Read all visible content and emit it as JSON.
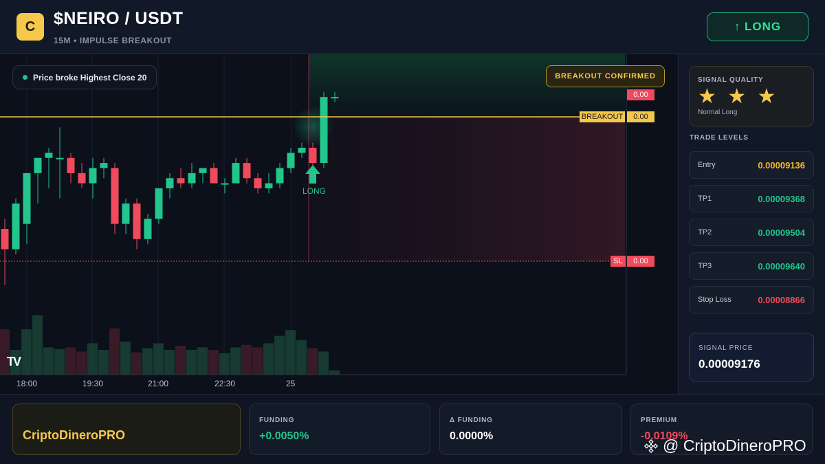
{
  "header": {
    "logo_letter": "C",
    "pair": "$NEIRO / USDT",
    "subtitle": "15M • IMPULSE BREAKOUT",
    "direction_button": "↑ LONG"
  },
  "chart": {
    "condition_text": "Price broke Highest Close 20",
    "badge": "BREAKOUT CONFIRMED",
    "signal_marker": "LONG",
    "tags": {
      "top_price": "0.00",
      "breakout_label": "BREAKOUT",
      "breakout_price": "0.00",
      "sl_label": "SL",
      "sl_price": "0.00"
    },
    "watermark_logo": "TV",
    "time_labels": [
      "18:00",
      "19:30",
      "21:00",
      "22:30",
      "25"
    ]
  },
  "chart_data": {
    "type": "candlestick",
    "interval": "15M",
    "candles": [
      {
        "o": 9.09e-05,
        "h": 9.11e-05,
        "l": 8.98e-05,
        "c": 9.05e-05
      },
      {
        "o": 9.05e-05,
        "h": 9.15e-05,
        "l": 9.04e-05,
        "c": 9.14e-05
      },
      {
        "o": 9.1e-05,
        "h": 9.19e-05,
        "l": 9.06e-05,
        "c": 9.2e-05
      },
      {
        "o": 9.2e-05,
        "h": 9.23e-05,
        "l": 9.14e-05,
        "c": 9.23e-05
      },
      {
        "o": 9.23e-05,
        "h": 9.25e-05,
        "l": 9.17e-05,
        "c": 9.24e-05
      },
      {
        "o": 9.23e-05,
        "h": 9.29e-05,
        "l": 9.15e-05,
        "c": 9.23e-05
      },
      {
        "o": 9.23e-05,
        "h": 9.24e-05,
        "l": 9.18e-05,
        "c": 9.2e-05
      },
      {
        "o": 9.2e-05,
        "h": 9.22e-05,
        "l": 9.17e-05,
        "c": 9.18e-05
      },
      {
        "o": 9.18e-05,
        "h": 9.23e-05,
        "l": 9.15e-05,
        "c": 9.21e-05
      },
      {
        "o": 9.21e-05,
        "h": 9.23e-05,
        "l": 9.19e-05,
        "c": 9.22e-05
      },
      {
        "o": 9.21e-05,
        "h": 9.22e-05,
        "l": 9.08e-05,
        "c": 9.1e-05
      },
      {
        "o": 9.1e-05,
        "h": 9.15e-05,
        "l": 9.08e-05,
        "c": 9.14e-05
      },
      {
        "o": 9.14e-05,
        "h": 9.15e-05,
        "l": 9.05e-05,
        "c": 9.07e-05
      },
      {
        "o": 9.07e-05,
        "h": 9.12e-05,
        "l": 9.06e-05,
        "c": 9.11e-05
      },
      {
        "o": 9.11e-05,
        "h": 9.17e-05,
        "l": 9.1e-05,
        "c": 9.17e-05
      },
      {
        "o": 9.17e-05,
        "h": 9.2e-05,
        "l": 9.15e-05,
        "c": 9.19e-05
      },
      {
        "o": 9.19e-05,
        "h": 9.21e-05,
        "l": 9.17e-05,
        "c": 9.18e-05
      },
      {
        "o": 9.18e-05,
        "h": 9.22e-05,
        "l": 9.17e-05,
        "c": 9.2e-05
      },
      {
        "o": 9.2e-05,
        "h": 9.21e-05,
        "l": 9.18e-05,
        "c": 9.21e-05
      },
      {
        "o": 9.21e-05,
        "h": 9.22e-05,
        "l": 9.18e-05,
        "c": 9.18e-05
      },
      {
        "o": 9.18e-05,
        "h": 9.19e-05,
        "l": 9.16e-05,
        "c": 9.18e-05
      },
      {
        "o": 9.18e-05,
        "h": 9.23e-05,
        "l": 9.18e-05,
        "c": 9.22e-05
      },
      {
        "o": 9.22e-05,
        "h": 9.23e-05,
        "l": 9.18e-05,
        "c": 9.19e-05
      },
      {
        "o": 9.19e-05,
        "h": 9.2e-05,
        "l": 9.16e-05,
        "c": 9.17e-05
      },
      {
        "o": 9.17e-05,
        "h": 9.2e-05,
        "l": 9.16e-05,
        "c": 9.18e-05
      },
      {
        "o": 9.18e-05,
        "h": 9.22e-05,
        "l": 9.17e-05,
        "c": 9.21e-05
      },
      {
        "o": 9.21e-05,
        "h": 9.25e-05,
        "l": 9.2e-05,
        "c": 9.24e-05
      },
      {
        "o": 9.24e-05,
        "h": 9.26e-05,
        "l": 9.23e-05,
        "c": 9.25e-05
      },
      {
        "o": 9.25e-05,
        "h": 9.26e-05,
        "l": 9.2e-05,
        "c": 9.22e-05
      },
      {
        "o": 9.22e-05,
        "h": 9.36e-05,
        "l": 9.21e-05,
        "c": 9.35e-05
      },
      {
        "o": 9.35e-05,
        "h": 9.36e-05,
        "l": 9.34e-05,
        "c": 9.35e-05
      }
    ],
    "volumes": [
      0.55,
      0.3,
      0.55,
      0.72,
      0.33,
      0.31,
      0.33,
      0.28,
      0.38,
      0.3,
      0.56,
      0.4,
      0.27,
      0.32,
      0.38,
      0.3,
      0.35,
      0.3,
      0.33,
      0.3,
      0.26,
      0.33,
      0.36,
      0.33,
      0.38,
      0.47,
      0.54,
      0.42,
      0.32,
      0.28,
      0.05
    ],
    "levels": {
      "breakout": 9.266e-05,
      "stop_loss": 9.006e-05
    },
    "x_ticks": [
      "18:00",
      "19:30",
      "21:00",
      "22:30",
      "25"
    ]
  },
  "signal_quality": {
    "title": "SIGNAL QUALITY",
    "stars": "★ ★ ★",
    "rating": 3,
    "subtitle": "Normal Long"
  },
  "trade_levels": {
    "title": "TRADE LEVELS",
    "rows": [
      {
        "label": "Entry",
        "value": "0.00009136",
        "color": "#f5b82e"
      },
      {
        "label": "TP1",
        "value": "0.00009368",
        "color": "#22c58b"
      },
      {
        "label": "TP2",
        "value": "0.00009504",
        "color": "#22c58b"
      },
      {
        "label": "TP3",
        "value": "0.00009640",
        "color": "#22c58b"
      },
      {
        "label": "Stop Loss",
        "value": "0.00008866",
        "color": "#f04a5c"
      }
    ]
  },
  "signal_price": {
    "title": "SIGNAL PRICE",
    "value": "0.00009176"
  },
  "footer": {
    "brand": "CriptoDineroPRO",
    "funding": {
      "title": "FUNDING",
      "value": "+0.0050%",
      "color": "#22c58b"
    },
    "delta_funding": {
      "title": "Δ FUNDING",
      "value": "0.0000%",
      "color": "#ffffff"
    },
    "premium": {
      "title": "PREMIUM",
      "value": "-0.0109%",
      "color": "#f04a5c"
    },
    "watermark": "@ CriptoDineroPRO"
  },
  "colors": {
    "bull": "#22c58b",
    "bear": "#f04a5c",
    "accent": "#f5c84a",
    "background": "#0f1522"
  }
}
